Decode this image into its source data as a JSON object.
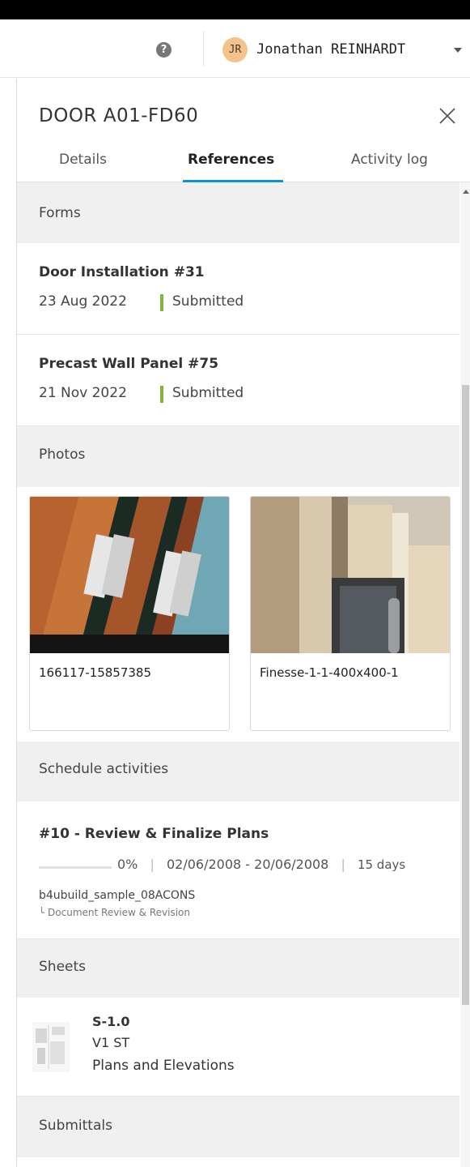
{
  "header": {
    "help_icon": "question-circle-icon",
    "help_glyph": "?",
    "user_initials": "JR",
    "user_name": "Jonathan REINHARDT",
    "avatar_color": "#f6c28b"
  },
  "panel": {
    "title": "DOOR A01-FD60",
    "tabs": [
      {
        "label": "Details",
        "active": false
      },
      {
        "label": "References",
        "active": true
      },
      {
        "label": "Activity log",
        "active": false
      }
    ],
    "accent_color": "#0696d7"
  },
  "forms": {
    "section_label": "Forms",
    "items": [
      {
        "title": "Door Installation  #31",
        "date": "23 Aug 2022",
        "status": "Submitted",
        "status_color": "#87b340"
      },
      {
        "title": "Precast Wall Panel  #75",
        "date": "21 Nov 2022",
        "status": "Submitted",
        "status_color": "#87b340"
      }
    ]
  },
  "photos": {
    "section_label": "Photos",
    "items": [
      {
        "name": "166117-15857385"
      },
      {
        "name": "Finesse-1-1-400x400-1"
      }
    ]
  },
  "schedule": {
    "section_label": "Schedule activities",
    "items": [
      {
        "title": "#10 - Review & Finalize Plans",
        "progress_percent": 0,
        "progress_label": "0%",
        "dates": "02/06/2008 - 20/06/2008",
        "duration": "15 days",
        "project": "b4ubuild_sample_08ACONS",
        "parent": "└ Document Review & Revision"
      }
    ]
  },
  "sheets": {
    "section_label": "Sheets",
    "items": [
      {
        "number": "S-1.0",
        "version": "V1 ST",
        "name": "Plans and Elevations"
      }
    ]
  },
  "submittals": {
    "section_label": "Submittals"
  }
}
